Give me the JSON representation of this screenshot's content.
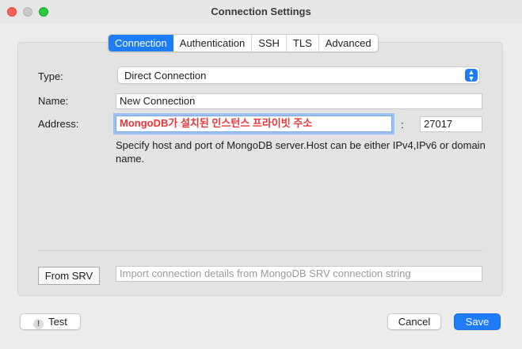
{
  "window": {
    "title": "Connection Settings"
  },
  "tabs": [
    {
      "label": "Connection",
      "active": true
    },
    {
      "label": "Authentication",
      "active": false
    },
    {
      "label": "SSH",
      "active": false
    },
    {
      "label": "TLS",
      "active": false
    },
    {
      "label": "Advanced",
      "active": false
    }
  ],
  "form": {
    "type_label": "Type:",
    "type_value": "Direct Connection",
    "name_label": "Name:",
    "name_value": "New Connection",
    "address_label": "Address:",
    "address_value": "MongoDB가 설치된 인스턴스 프라이빗 주소",
    "port_separator": ":",
    "port_value": "27017",
    "help_text": "Specify host and port of MongoDB server.Host can be either IPv4,IPv6 or domain name."
  },
  "srv": {
    "button_label": "From SRV",
    "input_placeholder": "Import connection details from MongoDB SRV connection string"
  },
  "footer": {
    "test_label": "Test",
    "test_icon": "!",
    "cancel_label": "Cancel",
    "save_label": "Save"
  },
  "colors": {
    "accent": "#1e7cf6",
    "address_text": "#e8363a",
    "close": "#fe5f57",
    "maximize": "#28c840"
  }
}
